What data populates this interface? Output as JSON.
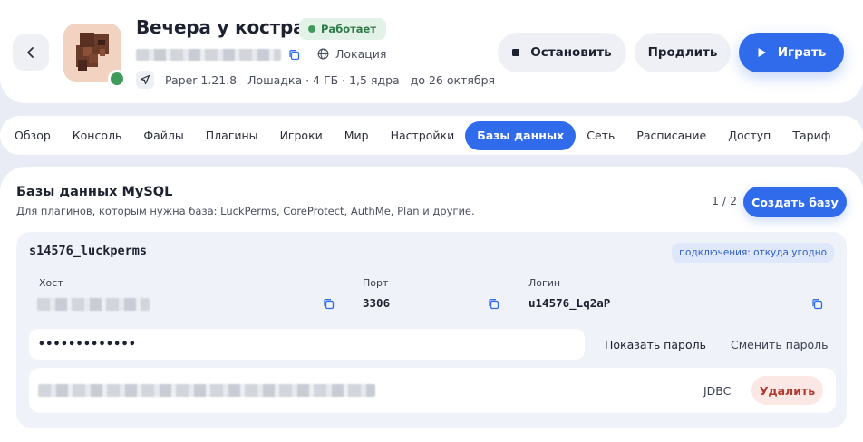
{
  "header": {
    "title": "Вечера у костра",
    "status": "Работает",
    "location": "Локация",
    "version": "Paper 1.21.8",
    "plan": "Лошадка · 4 ГБ · 1,5 ядра",
    "expires": "до 26 октября",
    "stop_label": "Остановить",
    "extend_label": "Продлить",
    "play_label": "Играть"
  },
  "tabs": [
    {
      "label": "Обзор"
    },
    {
      "label": "Консоль"
    },
    {
      "label": "Файлы"
    },
    {
      "label": "Плагины"
    },
    {
      "label": "Игроки"
    },
    {
      "label": "Мир"
    },
    {
      "label": "Настройки"
    },
    {
      "label": "Базы данных"
    },
    {
      "label": "Сеть"
    },
    {
      "label": "Расписание"
    },
    {
      "label": "Доступ"
    },
    {
      "label": "Тариф"
    }
  ],
  "active_tab": "Базы данных",
  "section": {
    "title": "Базы данных MySQL",
    "subtitle": "Для плагинов, которым нужна база: LuckPerms, CoreProtect, AuthMe, Plan и другие.",
    "pager": "1 / 2",
    "create_label": "Создать базу"
  },
  "database": {
    "name": "s14576_luckperms",
    "connections": "подключения: откуда угодно",
    "host_label": "Хост",
    "port_label": "Порт",
    "port": "3306",
    "login_label": "Логин",
    "login": "u14576_Lq2aP",
    "password_masked": "•••••••••••••",
    "show_password": "Показать пароль",
    "change_password": "Сменить пароль",
    "jdbc_label": "JDBC",
    "delete_label": "Удалить"
  },
  "colors": {
    "accent": "#2f6bea",
    "status_green": "#3f9a5c",
    "danger": "#b03a2e"
  }
}
